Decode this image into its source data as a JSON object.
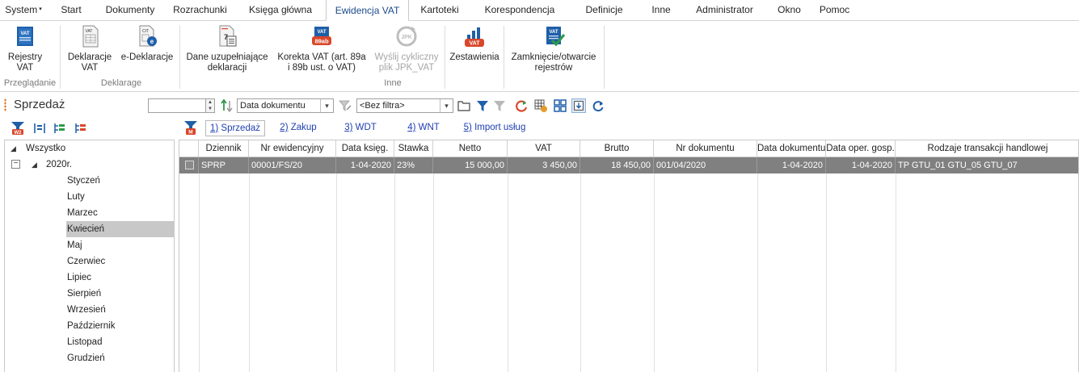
{
  "menu": {
    "items": [
      {
        "label": "System",
        "caret": "▾"
      },
      {
        "label": "Start"
      },
      {
        "label": "Dokumenty"
      },
      {
        "label": "Rozrachunki"
      },
      {
        "label": "Księga główna"
      },
      {
        "label": "Ewidencja VAT",
        "active": true
      },
      {
        "label": "Kartoteki"
      },
      {
        "label": "Korespondencja"
      },
      {
        "label": "Definicje"
      },
      {
        "label": "Inne"
      },
      {
        "label": "Administrator"
      },
      {
        "label": "Okno"
      },
      {
        "label": "Pomoc"
      }
    ]
  },
  "ribbon": {
    "buttons": {
      "rejestry": {
        "line1": "Rejestry",
        "line2": "VAT"
      },
      "deklaracje": {
        "line1": "Deklaracje",
        "line2": "VAT"
      },
      "edeklaracje": {
        "line1": "e-Deklaracje",
        "line2": ""
      },
      "dane": {
        "line1": "Dane uzupełniające",
        "line2": "deklaracji"
      },
      "korekta": {
        "line1": "Korekta VAT (art. 89a",
        "line2": "i 89b ust. o VAT)"
      },
      "jpk": {
        "line1": "Wyślij cykliczny",
        "line2": "plik JPK_VAT"
      },
      "zestawienia": {
        "line1": "Zestawienia",
        "line2": ""
      },
      "zamkniecie": {
        "line1": "Zamknięcie/otwarcie",
        "line2": "rejestrów"
      }
    },
    "icon_texts": {
      "vat": "VAT",
      "cit": "CIT",
      "seven": "7",
      "art89ab": "89ab",
      "jpk": "JPK"
    },
    "groups": {
      "przegladanie": "Przeglądanie",
      "deklarage": "Deklarage",
      "inne": "Inne"
    }
  },
  "filterbar": {
    "title": "Sprzedaż",
    "date_value": "",
    "sort_field": "Data dokumentu",
    "filter": "<Bez filtra>"
  },
  "side_tools": {
    "w2": "W2"
  },
  "tabs": {
    "m": "M",
    "items": [
      {
        "key": "1)",
        "label": " Sprzedaż"
      },
      {
        "key": "2)",
        "label": " Zakup"
      },
      {
        "key": "3)",
        "label": " WDT"
      },
      {
        "key": "4)",
        "label": " WNT"
      },
      {
        "key": "5)",
        "label": " Import usług"
      }
    ]
  },
  "tree": {
    "root": "Wszystko",
    "expander": "−",
    "year": "2020r.",
    "months": [
      "Styczeń",
      "Luty",
      "Marzec",
      "Kwiecień",
      "Maj",
      "Czerwiec",
      "Lipiec",
      "Sierpień",
      "Wrzesień",
      "Październik",
      "Listopad",
      "Grudzień"
    ],
    "selected_month": "Kwiecień"
  },
  "grid": {
    "columns": [
      "",
      "Dziennik",
      "Nr ewidencyjny",
      "Data księg.",
      "Stawka",
      "Netto",
      "VAT",
      "Brutto",
      "Nr dokumentu",
      "Data dokumentu",
      "Data oper. gosp.",
      "Rodzaje transakcji handlowej"
    ],
    "rows": [
      [
        "",
        "SPRP",
        "00001/FS/20",
        "1-04-2020",
        "23%",
        "15 000,00",
        "3 450,00",
        "18 450,00",
        "001/04/2020",
        "1-04-2020",
        "1-04-2020",
        "TP GTU_01 GTU_05 GTU_07"
      ]
    ]
  },
  "colors": {
    "accent": "#1a4a8c",
    "selected_row": "#808080",
    "icon_blue": "#1f5fa8",
    "icon_red": "#d9472b",
    "icon_green": "#2e9a4a"
  }
}
